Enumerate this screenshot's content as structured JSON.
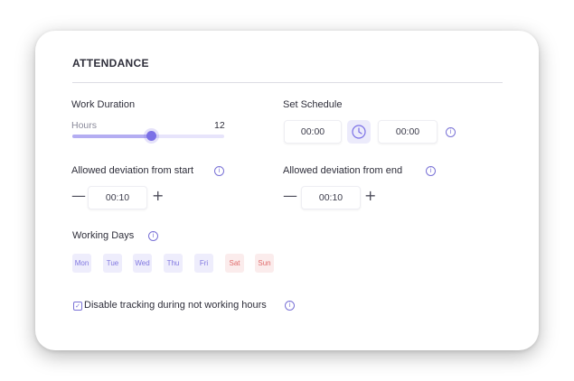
{
  "card": {
    "title": "ATTENDANCE"
  },
  "work_duration": {
    "label": "Work Duration",
    "slider_label": "Hours",
    "value": "12",
    "slider_fraction": 0.52
  },
  "schedule": {
    "label": "Set Schedule",
    "start": "00:00",
    "end": "00:00"
  },
  "deviation_start": {
    "label": "Allowed deviation from start",
    "value": "00:10",
    "minus": "—",
    "plus": "+"
  },
  "deviation_end": {
    "label": "Allowed deviation from end",
    "value": "00:10",
    "minus": "—",
    "plus": "+"
  },
  "working_days": {
    "label": "Working Days",
    "days": [
      "Mon",
      "Tue",
      "Wed",
      "Thu",
      "Fri",
      "Sat",
      "Sun"
    ]
  },
  "tracking": {
    "label": "Disable tracking during not working hours",
    "checked": true
  },
  "icons": {
    "info": "i",
    "check": "✓"
  },
  "colors": {
    "accent": "#7b70e6",
    "weekday_bg": "#eeedfc",
    "weekend_bg": "#fbecec",
    "weekend_text": "#e06b6b"
  }
}
